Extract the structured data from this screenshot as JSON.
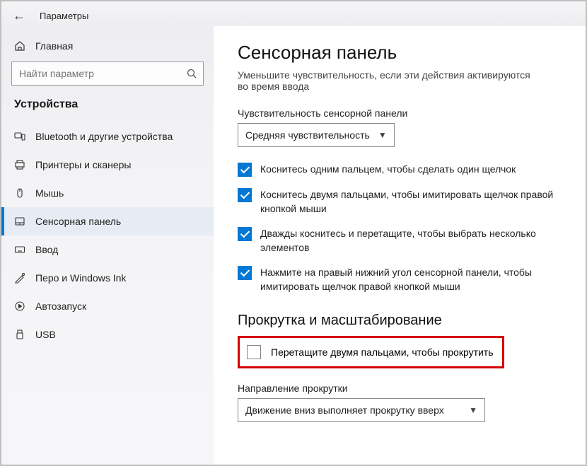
{
  "window": {
    "title": "Параметры"
  },
  "sidebar": {
    "home": "Главная",
    "search_placeholder": "Найти параметр",
    "section": "Устройства",
    "items": [
      {
        "label": "Bluetooth и другие устройства"
      },
      {
        "label": "Принтеры и сканеры"
      },
      {
        "label": "Мышь"
      },
      {
        "label": "Сенсорная панель"
      },
      {
        "label": "Ввод"
      },
      {
        "label": "Перо и Windows Ink"
      },
      {
        "label": "Автозапуск"
      },
      {
        "label": "USB"
      }
    ]
  },
  "page": {
    "title": "Сенсорная панель",
    "desc": "Уменьшите чувствительность, если эти действия активируются во время ввода",
    "sensitivity_label": "Чувствительность сенсорной панели",
    "sensitivity_value": "Средняя чувствительность",
    "checks": [
      "Коснитесь одним пальцем, чтобы сделать один щелчок",
      "Коснитесь двумя пальцами, чтобы имитировать щелчок правой кнопкой мыши",
      "Дважды коснитесь и перетащите, чтобы выбрать несколько элементов",
      "Нажмите на правый нижний угол сенсорной панели, чтобы имитировать щелчок правой кнопкой мыши"
    ],
    "scroll_heading": "Прокрутка и масштабирование",
    "scroll_check": "Перетащите двумя пальцами, чтобы прокрутить",
    "direction_label": "Направление прокрутки",
    "direction_value": "Движение вниз выполняет прокрутку вверх"
  }
}
